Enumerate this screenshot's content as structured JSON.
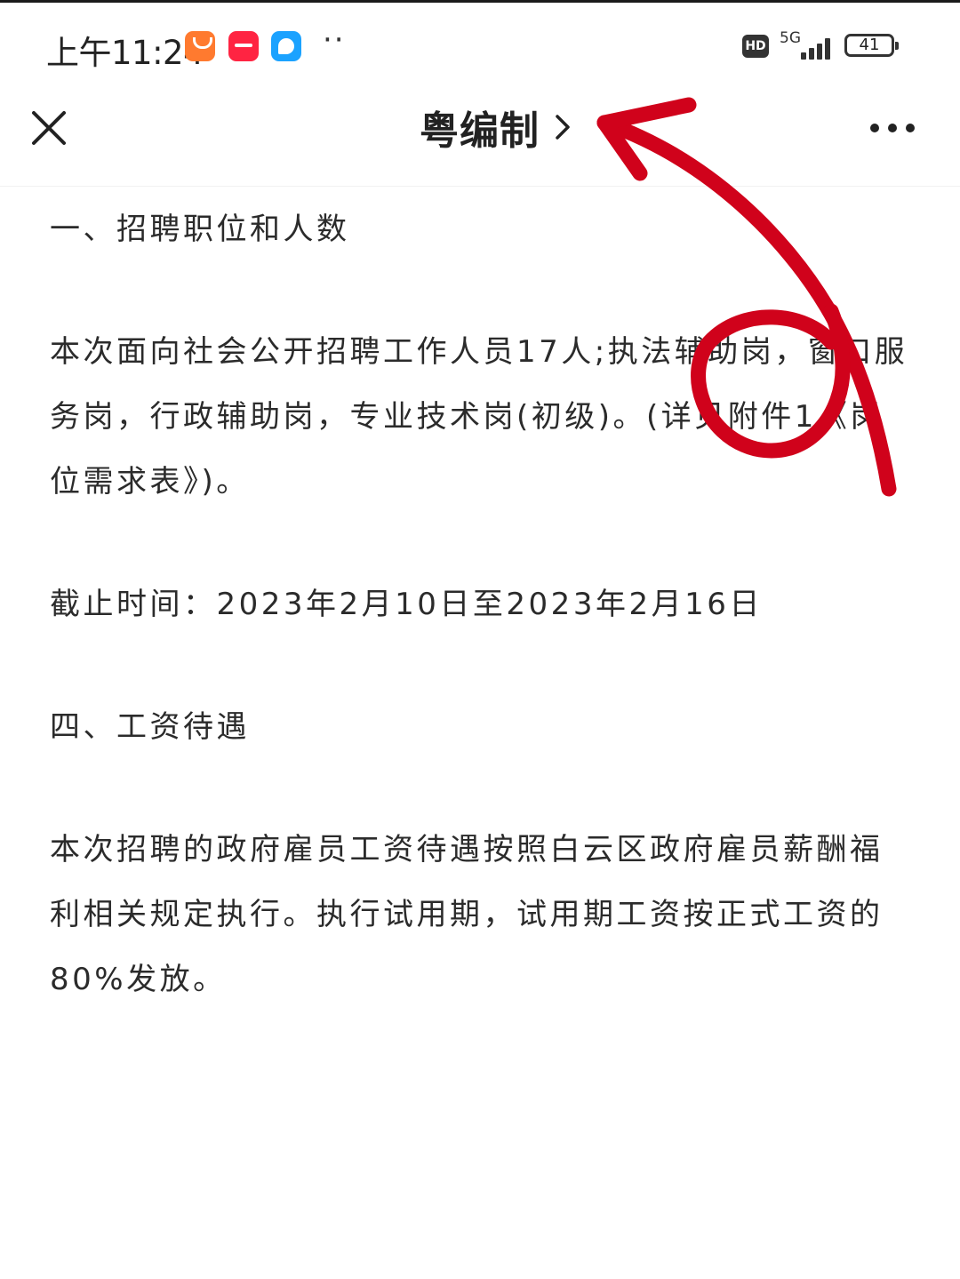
{
  "status_bar": {
    "time": "上午11:24",
    "network": "5G",
    "hd": "HD",
    "battery": "41",
    "apps": [
      "mi-shop-icon",
      "xiaohongshu-icon",
      "message-icon"
    ],
    "more": "··"
  },
  "nav": {
    "title": "粤编制"
  },
  "content": {
    "section1_heading": "一、招聘职位和人数",
    "section1_body": "本次面向社会公开招聘工作人员17人;执法辅助岗，窗口服务岗，行政辅助岗，专业技术岗(初级)。(详见附件1《岗位需求表》)。",
    "deadline": "截止时间：2023年2月10日至2023年2月16日",
    "section4_heading": "四、工资待遇",
    "section4_body": "本次招聘的政府雇员工资待遇按照白云区政府雇员薪酬福利相关规定执行。执行试用期，试用期工资按正式工资的80%发放。"
  },
  "colors": {
    "annotation": "#d0021b",
    "text": "#2b2b2b"
  }
}
